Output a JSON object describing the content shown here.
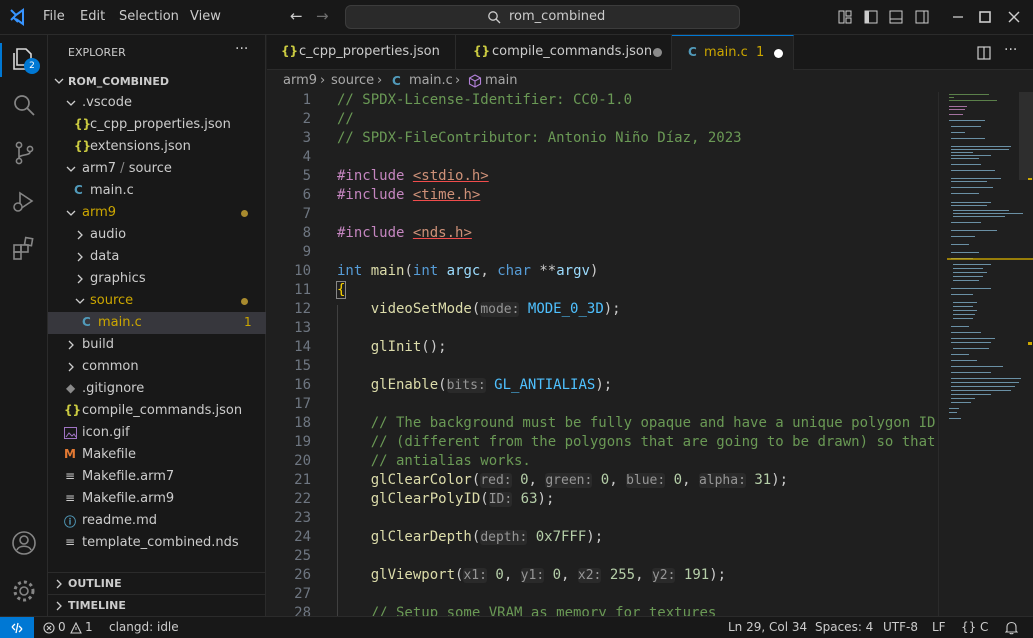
{
  "titlebar": {
    "menu": [
      "File",
      "Edit",
      "Selection",
      "View"
    ],
    "search_text": "rom_combined"
  },
  "activitybar": {
    "explorer_badge": "2"
  },
  "sidebar": {
    "header": "EXPLORER",
    "more": "···",
    "root": "ROM_COMBINED",
    "items": [
      {
        "label": "vscode",
        "prefix": "."
      },
      {
        "label": "c_cpp_properties.json",
        "icon": "{}"
      },
      {
        "label": "extensions.json",
        "icon": "{}"
      },
      {
        "label": "arm7",
        "sep": " / ",
        "label2": "source"
      },
      {
        "label": "main.c",
        "icon": "C"
      },
      {
        "label": "arm9"
      },
      {
        "label": "audio"
      },
      {
        "label": "data"
      },
      {
        "label": "graphics"
      },
      {
        "label": "source"
      },
      {
        "label": "main.c",
        "icon": "C",
        "problems": "1"
      },
      {
        "label": "build"
      },
      {
        "label": "common"
      },
      {
        "label": ".gitignore"
      },
      {
        "label": "compile_commands.json",
        "icon": "{}"
      },
      {
        "label": "icon.gif"
      },
      {
        "label": "Makefile",
        "icon": "M"
      },
      {
        "label": "Makefile.arm7"
      },
      {
        "label": "Makefile.arm9"
      },
      {
        "label": "readme.md"
      },
      {
        "label": "template_combined.nds"
      }
    ],
    "outline": "OUTLINE",
    "timeline": "TIMELINE"
  },
  "tabs": [
    {
      "label": "c_cpp_properties.json",
      "icon": "{}"
    },
    {
      "label": "compile_commands.json",
      "icon": "{}"
    },
    {
      "label": "main.c",
      "icon": "C",
      "problems": "1"
    }
  ],
  "breadcrumb": [
    "arm9",
    "source",
    "main.c",
    "main"
  ],
  "editor": {
    "line_numbers": [
      "1",
      "2",
      "3",
      "4",
      "5",
      "6",
      "7",
      "8",
      "9",
      "10",
      "11",
      "12",
      "13",
      "14",
      "15",
      "16",
      "17",
      "18",
      "19",
      "20",
      "21",
      "22",
      "23",
      "24",
      "25",
      "26",
      "27",
      "28"
    ],
    "lines": {
      "l1": "// SPDX-License-Identifier: CC0-1.0",
      "l2": "//",
      "l3": "// SPDX-FileContributor: Antonio Niño Díaz, 2023",
      "l5_pp": "#include",
      "l5_inc": "<stdio.h>",
      "l6_pp": "#include",
      "l6_inc": "<time.h>",
      "l8_pp": "#include",
      "l8_inc": "<nds.h>",
      "l10_kw1": "int",
      "l10_fn": "main",
      "l10_p1": "(",
      "l10_kw2": "int",
      "l10_v1": "argc",
      "l10_c": ", ",
      "l10_kw3": "char",
      "l10_st": " **",
      "l10_v2": "argv",
      "l10_end": ")",
      "l11": "{",
      "l12_fn": "videoSetMode",
      "l12_h1": "mode:",
      "l12_c1": "MODE_0_3D",
      "l12_end": ");",
      "l14_fn": "glInit",
      "l14_end": "();",
      "l16_fn": "glEnable",
      "l16_h1": "bits:",
      "l16_c1": "GL_ANTIALIAS",
      "l16_end": ");",
      "l18": "// The background must be fully opaque and have a unique polygon ID",
      "l19": "// (different from the polygons that are going to be drawn) so that",
      "l20": "// antialias works.",
      "l21_fn": "glClearColor",
      "l21_h1": "red:",
      "l21_n1": "0",
      "l21_h2": "green:",
      "l21_n2": "0",
      "l21_h3": "blue:",
      "l21_n3": "0",
      "l21_h4": "alpha:",
      "l21_n4": "31",
      "l21_end": ");",
      "l22_fn": "glClearPolyID",
      "l22_h1": "ID:",
      "l22_n1": "63",
      "l22_end": ");",
      "l24_fn": "glClearDepth",
      "l24_h1": "depth:",
      "l24_n1": "0x7FFF",
      "l24_end": ");",
      "l26_fn": "glViewport",
      "l26_h1": "x1:",
      "l26_n1": "0",
      "l26_h2": "y1:",
      "l26_n2": "0",
      "l26_h3": "x2:",
      "l26_n3": "255",
      "l26_h4": "y2:",
      "l26_n4": "191",
      "l26_end": ");",
      "l28": "// Setup some VRAM as memory for textures"
    }
  },
  "statusbar": {
    "errors": "0",
    "warnings": "1",
    "clangd": "clangd: idle",
    "position": "Ln 29, Col 34",
    "spaces": "Spaces: 4",
    "encoding": "UTF-8",
    "eol": "LF",
    "language": "C",
    "lang_prefix": "{}"
  },
  "colors": {
    "accent": "#0078d4",
    "warning": "#cca700",
    "modified_dot": "#a88a2e"
  }
}
